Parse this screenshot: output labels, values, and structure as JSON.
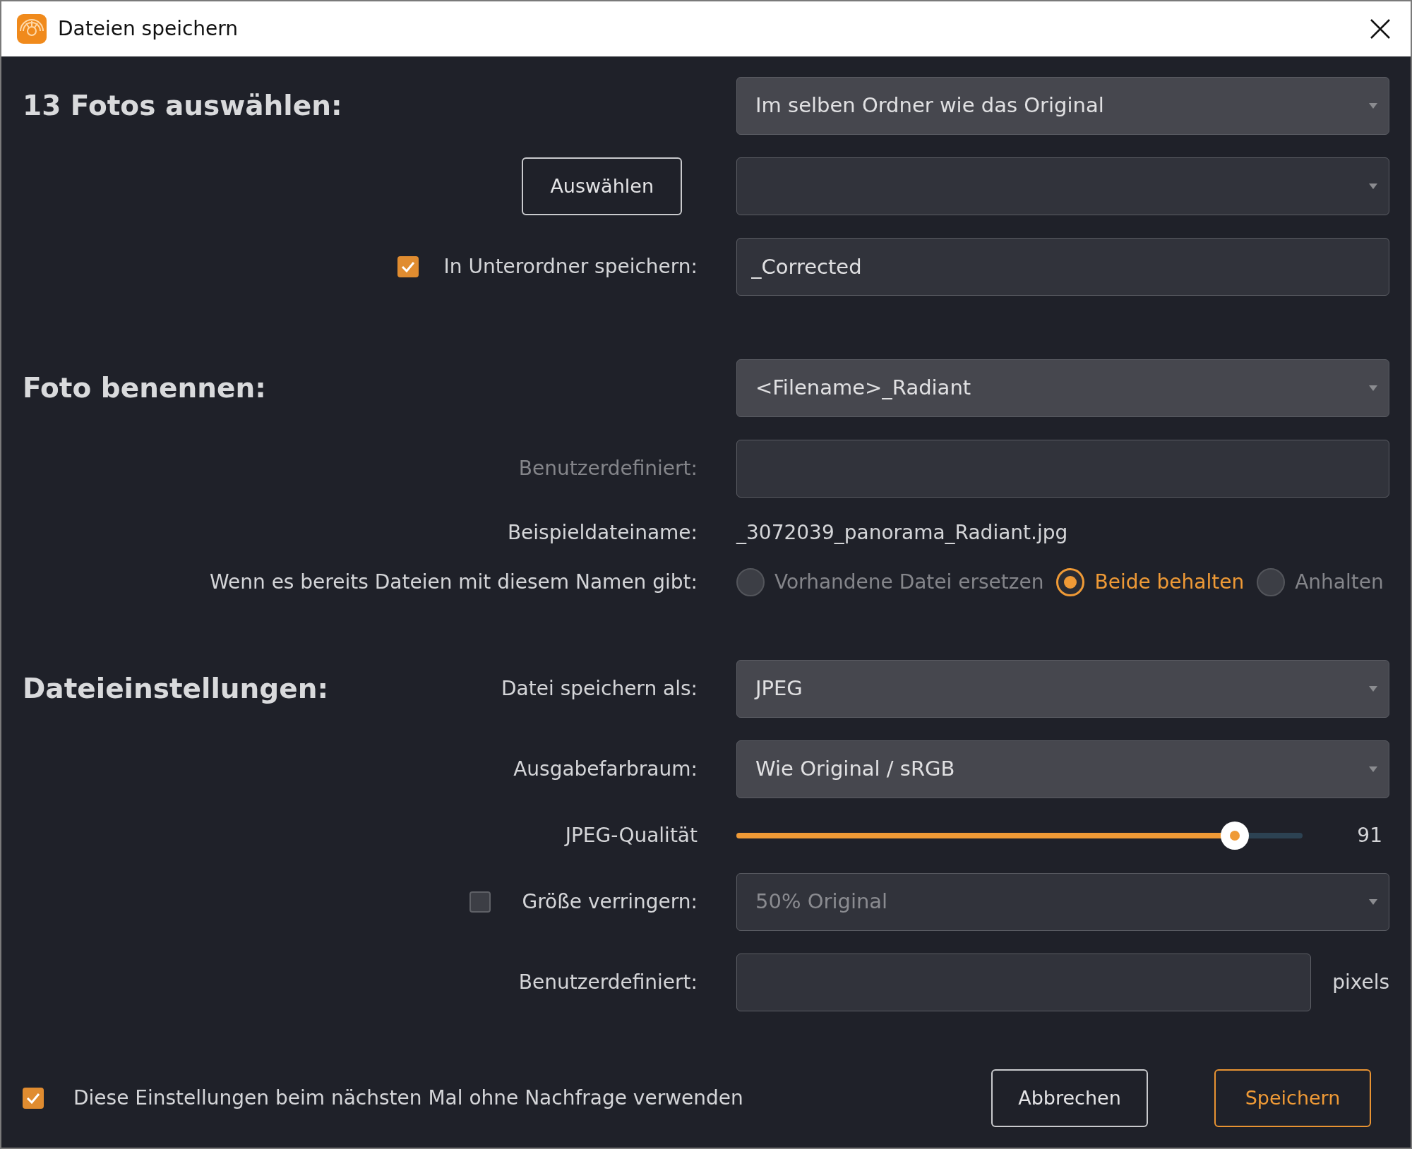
{
  "window": {
    "title": "Dateien speichern"
  },
  "sections": [
    {
      "heading": "13 Fotos auswählen:",
      "rows": [
        {
          "kind": "dropdown",
          "value": "Im selben Ordner wie das Original"
        },
        {
          "kind": "button_dropdown",
          "button": "Auswählen",
          "disabled": true
        },
        {
          "kind": "check_field",
          "label": "In Unterordner speichern:",
          "checked": true,
          "value": "_Corrected"
        }
      ]
    },
    {
      "heading": "Foto benennen:",
      "rows": [
        {
          "kind": "dropdown",
          "value": "<Filename>_Radiant"
        },
        {
          "kind": "field",
          "label": "Benutzerdefiniert:",
          "disabled": true
        },
        {
          "kind": "text",
          "label": "Beispieldateiname:",
          "value": "_3072039_panorama_Radiant.jpg"
        },
        {
          "kind": "radios",
          "label": "Wenn es bereits Dateien mit diesem Namen gibt:",
          "options": [
            {
              "label": "Vorhandene Datei ersetzen",
              "selected": false
            },
            {
              "label": "Beide behalten",
              "selected": true
            },
            {
              "label": "Anhalten",
              "selected": false
            }
          ]
        }
      ]
    },
    {
      "heading": "Dateieinstellungen:",
      "rows": [
        {
          "kind": "dropdown",
          "label": "Datei speichern als:",
          "value": "JPEG"
        },
        {
          "kind": "dropdown",
          "label": "Ausgabefarbraum:",
          "value": "Wie Original / sRGB"
        },
        {
          "kind": "slider",
          "label": "JPEG-Qualität",
          "level": 0.88,
          "reading": "91"
        },
        {
          "kind": "check_dropdown",
          "label": "Größe verringern:",
          "checked": false,
          "value": "50% Original"
        },
        {
          "kind": "field",
          "label": "Benutzerdefiniert:",
          "disabled": false,
          "suffix": "pixels"
        }
      ]
    }
  ],
  "footer": {
    "remember": {
      "label": "Diese Einstellungen beim nächsten Mal ohne Nachfrage verwenden",
      "checked": true
    },
    "buttons": [
      {
        "label": "Abbrechen",
        "primary": false
      },
      {
        "label": "Speichern",
        "primary": true
      }
    ]
  }
}
